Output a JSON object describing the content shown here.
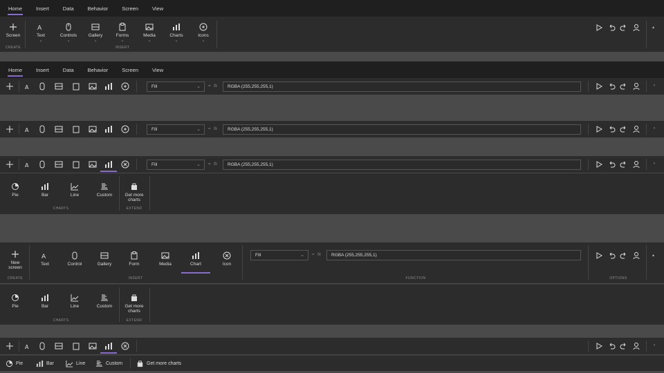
{
  "colors": {
    "accent": "#8a6cd0",
    "bg_dark": "#1f1f1f",
    "ribbon": "#2c2c2c",
    "gap": "#4a4a4a"
  },
  "tabs": [
    "Home",
    "Insert",
    "Data",
    "Behavior",
    "Screen",
    "View"
  ],
  "ribbon1": {
    "screen": "Screen",
    "text": "Text",
    "controls": "Controls",
    "gallery": "Gallery",
    "forms": "Forms",
    "media": "Media",
    "charts": "Charts",
    "icons": "Icons",
    "group_create": "CREATE",
    "group_insert": "INSERT"
  },
  "formula": {
    "property": "Fill",
    "eq": "=",
    "fx": "fx",
    "value": "RGBA (255,255,255,1)"
  },
  "charts_panel": {
    "pie": "Pie",
    "bar": "Bar",
    "line": "Line",
    "custom": "Custom",
    "get_more_line1": "Get more",
    "get_more_line2": "charts",
    "group_charts": "CHARTS",
    "group_extend": "EXTEND"
  },
  "ribbon5": {
    "new_screen_line1": "New",
    "new_screen_line2": "screen",
    "text": "Text",
    "control": "Control",
    "gallery": "Gallery",
    "form": "Form",
    "media": "Media",
    "chart": "Chart",
    "icon": "Icon",
    "group_create": "CREATE",
    "group_insert": "INSERT",
    "group_function": "FUNCTION",
    "group_options": "OPTIONS"
  },
  "bottom_bar": {
    "pie": "Pie",
    "bar": "Bar",
    "line": "Line",
    "custom": "Custom",
    "get_more": "Get more charts"
  }
}
